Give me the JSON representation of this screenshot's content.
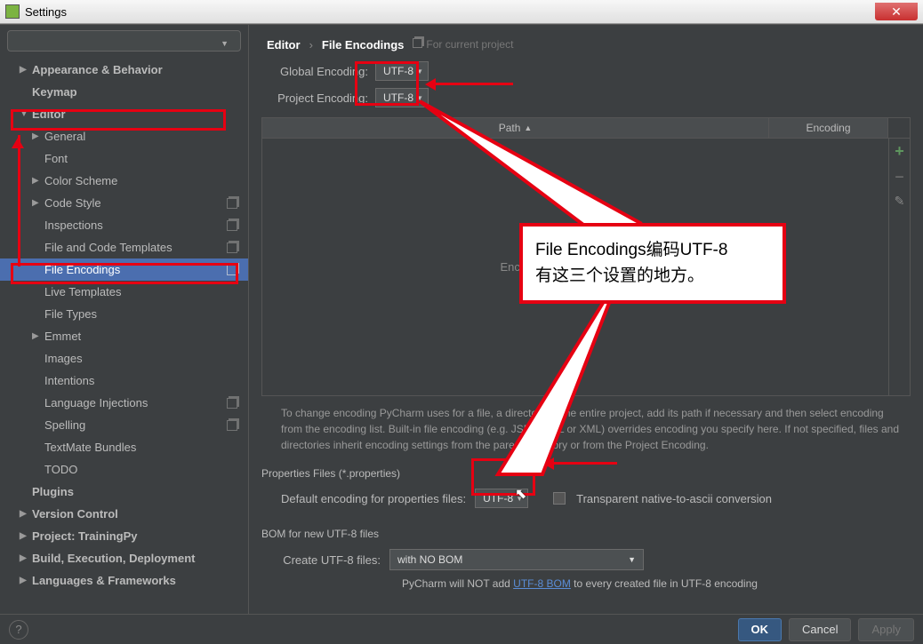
{
  "window": {
    "title": "Settings"
  },
  "search": {
    "placeholder": ""
  },
  "sidebar": {
    "items": [
      {
        "label": "Appearance & Behavior",
        "expand": "▶",
        "bold": true,
        "lvl": 0
      },
      {
        "label": "Keymap",
        "expand": "",
        "bold": true,
        "lvl": 0
      },
      {
        "label": "Editor",
        "expand": "▼",
        "bold": true,
        "lvl": 0
      },
      {
        "label": "General",
        "expand": "▶",
        "bold": false,
        "lvl": 1
      },
      {
        "label": "Font",
        "expand": "",
        "bold": false,
        "lvl": 1
      },
      {
        "label": "Color Scheme",
        "expand": "▶",
        "bold": false,
        "lvl": 1
      },
      {
        "label": "Code Style",
        "expand": "▶",
        "bold": false,
        "lvl": 1,
        "copy": true
      },
      {
        "label": "Inspections",
        "expand": "",
        "bold": false,
        "lvl": 1,
        "copy": true
      },
      {
        "label": "File and Code Templates",
        "expand": "",
        "bold": false,
        "lvl": 1,
        "copy": true
      },
      {
        "label": "File Encodings",
        "expand": "",
        "bold": false,
        "lvl": 1,
        "copy": true,
        "selected": true
      },
      {
        "label": "Live Templates",
        "expand": "",
        "bold": false,
        "lvl": 1
      },
      {
        "label": "File Types",
        "expand": "",
        "bold": false,
        "lvl": 1
      },
      {
        "label": "Emmet",
        "expand": "▶",
        "bold": false,
        "lvl": 1
      },
      {
        "label": "Images",
        "expand": "",
        "bold": false,
        "lvl": 1
      },
      {
        "label": "Intentions",
        "expand": "",
        "bold": false,
        "lvl": 1
      },
      {
        "label": "Language Injections",
        "expand": "",
        "bold": false,
        "lvl": 1,
        "copy": true
      },
      {
        "label": "Spelling",
        "expand": "",
        "bold": false,
        "lvl": 1,
        "copy": true
      },
      {
        "label": "TextMate Bundles",
        "expand": "",
        "bold": false,
        "lvl": 1
      },
      {
        "label": "TODO",
        "expand": "",
        "bold": false,
        "lvl": 1
      },
      {
        "label": "Plugins",
        "expand": "",
        "bold": true,
        "lvl": 0
      },
      {
        "label": "Version Control",
        "expand": "▶",
        "bold": true,
        "lvl": 0
      },
      {
        "label": "Project: TrainingPy",
        "expand": "▶",
        "bold": true,
        "lvl": 0
      },
      {
        "label": "Build, Execution, Deployment",
        "expand": "▶",
        "bold": true,
        "lvl": 0
      },
      {
        "label": "Languages & Frameworks",
        "expand": "▶",
        "bold": true,
        "lvl": 0
      }
    ]
  },
  "breadcrumb": {
    "root": "Editor",
    "page": "File Encodings",
    "tag": "For current project"
  },
  "encodings": {
    "global_label": "Global Encoding:",
    "global_value": "UTF-8",
    "project_label": "Project Encoding:",
    "project_value": "UTF-8"
  },
  "table": {
    "col_path": "Path",
    "col_enc": "Encoding",
    "empty": "Encodings are not configured"
  },
  "hint_text": "To change encoding PyCharm uses for a file, a directory or the entire project, add its path if necessary and then select encoding from the encoding list. Built-in file encoding (e.g. JSP, HTML or XML) overrides encoding you specify here. If not specified, files and directories inherit encoding settings from the parent directory or from the Project Encoding.",
  "props": {
    "section": "Properties Files (*.properties)",
    "label": "Default encoding for properties files:",
    "value": "UTF-8",
    "checkbox": "Transparent native-to-ascii conversion"
  },
  "bom": {
    "section": "BOM for new UTF-8 files",
    "label": "Create UTF-8 files:",
    "value": "with NO BOM",
    "note_pre": "PyCharm will NOT add ",
    "note_link": "UTF-8 BOM",
    "note_post": " to every created file in UTF-8 encoding"
  },
  "buttons": {
    "ok": "OK",
    "cancel": "Cancel",
    "apply": "Apply"
  },
  "callout": {
    "line1": "File  Encodings编码UTF-8",
    "line2": "有这三个设置的地方。"
  }
}
